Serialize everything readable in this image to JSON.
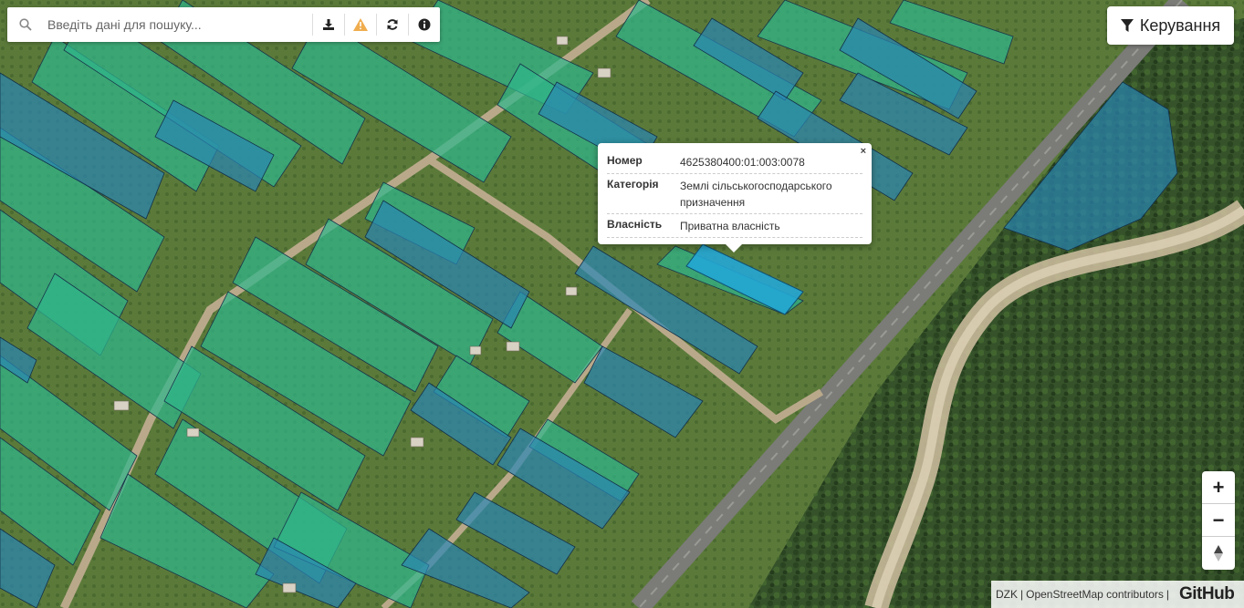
{
  "search": {
    "placeholder": "Введіть дані для пошуку..."
  },
  "toolbar": {
    "icons": [
      "download-icon",
      "warning-icon",
      "refresh-icon",
      "info-icon"
    ],
    "warning_color": "#f0ad4e"
  },
  "control": {
    "label": "Керування",
    "icon": "filter-icon"
  },
  "popup": {
    "close_symbol": "×",
    "rows": [
      {
        "key": "Номер",
        "value": "4625380400:01:003:0078"
      },
      {
        "key": "Категорія",
        "value": "Землі сільськогосподарського призначення"
      },
      {
        "key": "Власність",
        "value": "Приватна власність"
      }
    ]
  },
  "zoom": {
    "in_label": "+",
    "out_label": "−",
    "north_label": "▲"
  },
  "attribution": {
    "dzk": "DZK",
    "osm": "OpenStreetMap contributors",
    "separator": "|",
    "github": "GitHub"
  },
  "colors": {
    "parcel_green": "#2fb58a",
    "parcel_blue": "#2a86b4",
    "parcel_selected": "#23a6d5",
    "vegetation": "#3f5c2b"
  }
}
